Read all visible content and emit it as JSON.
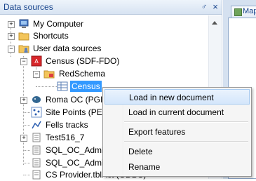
{
  "panel": {
    "title": "Data sources",
    "pin_glyph": "♂",
    "close_glyph": "×"
  },
  "document_tab": {
    "label": "Map"
  },
  "tree": {
    "my_computer": "My Computer",
    "shortcuts": "Shortcuts",
    "user_data_sources": "User data sources",
    "census_sdf": "Census (SDF-FDO)",
    "red_schema": "RedSchema",
    "census": "Census",
    "roma_oc": "Roma OC (PGIS",
    "site_points": "Site Points (PEN",
    "fells_tracks": "Fells tracks",
    "test516": "Test516_7",
    "sql_oc_admin_1": "SQL_OC_Admin",
    "sql_oc_admin_2": "SQL_OC_Admin",
    "cs_provider": "CS Provider.tblAct (ODBC)"
  },
  "context_menu": {
    "load_new": "Load in new document",
    "load_current": "Load in current document",
    "export": "Export features",
    "delete": "Delete",
    "rename": "Rename"
  },
  "colors": {
    "accent": "#3399ff",
    "title_text": "#15428b",
    "menu_hover": "#d4e6fb"
  }
}
